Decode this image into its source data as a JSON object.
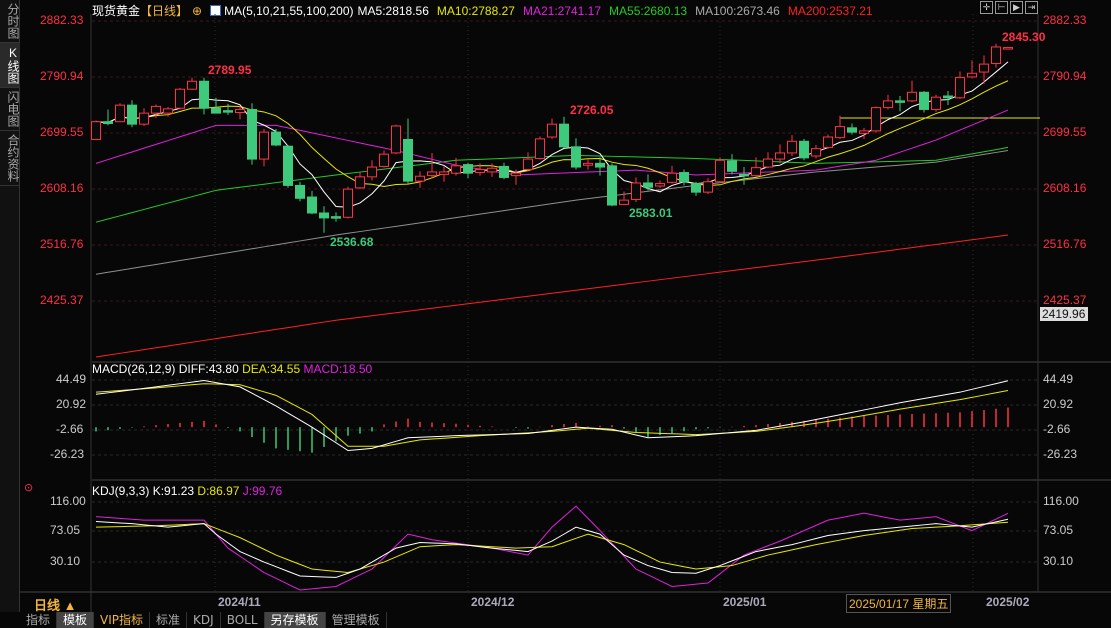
{
  "sidebar": {
    "tabs": [
      {
        "label": "分时图"
      },
      {
        "label": "K线图"
      },
      {
        "label": "闪电图"
      },
      {
        "label": "合约资料"
      }
    ]
  },
  "header": {
    "name": "现货黄金",
    "period": "【日线】",
    "ma_label": "MA(5,10,21,55,100,200)",
    "ma5": "MA5:2818.56",
    "ma10": "MA10:2788.27",
    "ma21": "MA21:2741.17",
    "ma55": "MA55:2680.13",
    "ma100": "MA100:2673.46",
    "ma200": "MA200:2537.21"
  },
  "colors": {
    "up": "#ff3046",
    "down": "#3ec97c",
    "ma5": "#ffffff",
    "ma10": "#e8e800",
    "ma21": "#e020e0",
    "ma55": "#22cc22",
    "ma100": "#909090",
    "ma200": "#ff2020"
  },
  "price_axis": [
    "2882.33",
    "2790.94",
    "2699.55",
    "2608.16",
    "2516.76",
    "2425.37"
  ],
  "price_box": "2419.96",
  "annotations": {
    "high1": "2789.95",
    "high2": "2726.05",
    "low1": "2536.68",
    "low2": "2583.01",
    "last_high": "2845.30"
  },
  "macd": {
    "title": "MACD(26,12,9)",
    "diff": "DIFF:43.80",
    "dea": "DEA:34.55",
    "macd": "MACD:18.50",
    "axis": [
      "44.49",
      "20.92",
      "-2.66",
      "-26.23"
    ]
  },
  "kdj": {
    "title": "KDJ(9,3,3)",
    "k": "K:91.23",
    "d": "D:86.97",
    "j": "J:99.76",
    "axis": [
      "116.00",
      "73.05",
      "30.10"
    ]
  },
  "dates": {
    "d1": "2024/11",
    "d2": "2024/12",
    "d3": "2025/01",
    "d4": "2025/02",
    "cursor": "2025/01/17 星期五"
  },
  "period_selector": "日线 ▲",
  "toolbar": [
    "指标",
    "模板",
    "VIP指标",
    "标准",
    "KDJ",
    "BOLL",
    "另存模板",
    "管理模板"
  ],
  "chart_data": {
    "type": "candlestick",
    "candles": [
      [
        2689,
        2720,
        2688,
        2718
      ],
      [
        2718,
        2738,
        2712,
        2715
      ],
      [
        2718,
        2748,
        2718,
        2745
      ],
      [
        2745,
        2753,
        2709,
        2714
      ],
      [
        2714,
        2740,
        2711,
        2732
      ],
      [
        2732,
        2746,
        2724,
        2743
      ],
      [
        2732,
        2742,
        2726,
        2739
      ],
      [
        2740,
        2773,
        2738,
        2771
      ],
      [
        2771,
        2790,
        2770,
        2784
      ],
      [
        2784,
        2789.95,
        2730,
        2740
      ],
      [
        2740,
        2757,
        2732,
        2732
      ],
      [
        2736,
        2747,
        2729,
        2734
      ],
      [
        2733,
        2744,
        2722,
        2738
      ],
      [
        2738,
        2748,
        2648,
        2657
      ],
      [
        2657,
        2706,
        2645,
        2701
      ],
      [
        2701,
        2706,
        2678,
        2680
      ],
      [
        2678,
        2680,
        2610,
        2614
      ],
      [
        2614,
        2620,
        2588,
        2593
      ],
      [
        2595,
        2605,
        2567,
        2569
      ],
      [
        2569,
        2580,
        2536.68,
        2561
      ],
      [
        2563,
        2570,
        2555,
        2561
      ],
      [
        2562,
        2612,
        2560,
        2608
      ],
      [
        2610,
        2636,
        2608,
        2628
      ],
      [
        2628,
        2655,
        2622,
        2644
      ],
      [
        2645,
        2671,
        2643,
        2665
      ],
      [
        2667,
        2713,
        2665,
        2711
      ],
      [
        2689,
        2723,
        2616,
        2621
      ],
      [
        2621,
        2637,
        2610,
        2629
      ],
      [
        2630,
        2667,
        2625,
        2636
      ],
      [
        2632,
        2645,
        2620,
        2636
      ],
      [
        2634,
        2659,
        2630,
        2646
      ],
      [
        2648,
        2651,
        2626,
        2634
      ],
      [
        2635,
        2650,
        2630,
        2640
      ],
      [
        2636,
        2650,
        2628,
        2642
      ],
      [
        2645,
        2651,
        2624,
        2627
      ],
      [
        2630,
        2640,
        2615,
        2634
      ],
      [
        2640,
        2668,
        2638,
        2657
      ],
      [
        2658,
        2694,
        2656,
        2690
      ],
      [
        2693,
        2723,
        2690,
        2714
      ],
      [
        2714,
        2726.05,
        2675,
        2677
      ],
      [
        2677,
        2691,
        2640,
        2644
      ],
      [
        2647,
        2657,
        2640,
        2650
      ],
      [
        2650,
        2660,
        2630,
        2644
      ],
      [
        2646,
        2650,
        2580,
        2582
      ],
      [
        2583,
        2604,
        2583.01,
        2590
      ],
      [
        2591,
        2627,
        2587,
        2618
      ],
      [
        2618,
        2632,
        2606,
        2611
      ],
      [
        2613,
        2622,
        2610,
        2617
      ],
      [
        2619,
        2646,
        2617,
        2634
      ],
      [
        2635,
        2640,
        2614,
        2620
      ],
      [
        2617,
        2620,
        2597,
        2603
      ],
      [
        2603,
        2626,
        2600,
        2620
      ],
      [
        2620,
        2660,
        2618,
        2655
      ],
      [
        2654,
        2665,
        2632,
        2637
      ],
      [
        2632,
        2644,
        2615,
        2631
      ],
      [
        2630,
        2660,
        2628,
        2643
      ],
      [
        2644,
        2668,
        2642,
        2657
      ],
      [
        2657,
        2681,
        2650,
        2667
      ],
      [
        2667,
        2696,
        2662,
        2686
      ],
      [
        2686,
        2690,
        2655,
        2659
      ],
      [
        2662,
        2680,
        2658,
        2674
      ],
      [
        2676,
        2697,
        2674,
        2693
      ],
      [
        2692,
        2728,
        2690,
        2710
      ],
      [
        2708,
        2715,
        2697,
        2701
      ],
      [
        2699,
        2708,
        2690,
        2703
      ],
      [
        2703,
        2743,
        2700,
        2741
      ],
      [
        2741,
        2762,
        2738,
        2752
      ],
      [
        2752,
        2760,
        2735,
        2751
      ],
      [
        2752,
        2785,
        2750,
        2766
      ],
      [
        2766,
        2768,
        2733,
        2738
      ],
      [
        2738,
        2762,
        2734,
        2758
      ],
      [
        2760,
        2768,
        2745,
        2757
      ],
      [
        2757,
        2800,
        2755,
        2790
      ],
      [
        2791,
        2818,
        2789,
        2797
      ],
      [
        2799,
        2826,
        2780,
        2812
      ],
      [
        2813,
        2845.3,
        2806,
        2840
      ],
      [
        2838,
        2840,
        2837,
        2839
      ]
    ],
    "ma21": [
      [
        0,
        2650
      ],
      [
        10,
        2712
      ],
      [
        15,
        2712
      ],
      [
        25,
        2671
      ],
      [
        30,
        2647
      ],
      [
        35,
        2631
      ],
      [
        45,
        2639
      ],
      [
        50,
        2631
      ],
      [
        60,
        2639
      ],
      [
        65,
        2655
      ],
      [
        70,
        2688
      ],
      [
        76,
        2737
      ]
    ],
    "ma55": [
      [
        0,
        2554
      ],
      [
        10,
        2606
      ],
      [
        20,
        2631
      ],
      [
        30,
        2655
      ],
      [
        40,
        2663
      ],
      [
        50,
        2658
      ],
      [
        60,
        2650
      ],
      [
        70,
        2655
      ],
      [
        76,
        2676
      ]
    ],
    "ma100": [
      [
        0,
        2469
      ],
      [
        20,
        2533
      ],
      [
        40,
        2590
      ],
      [
        50,
        2614
      ],
      [
        60,
        2636
      ],
      [
        70,
        2652
      ],
      [
        76,
        2671
      ]
    ],
    "ma200": [
      [
        0,
        2334
      ],
      [
        20,
        2394
      ],
      [
        40,
        2443
      ],
      [
        60,
        2492
      ],
      [
        76,
        2533
      ]
    ],
    "resistance_line": 2724,
    "macd_diff": [
      [
        0,
        31
      ],
      [
        5,
        38
      ],
      [
        9,
        44
      ],
      [
        12,
        38
      ],
      [
        15,
        20
      ],
      [
        18,
        0
      ],
      [
        21,
        -22
      ],
      [
        23,
        -20
      ],
      [
        26,
        -10
      ],
      [
        30,
        -8
      ],
      [
        36,
        -6
      ],
      [
        40,
        0
      ],
      [
        43,
        -2
      ],
      [
        46,
        -10
      ],
      [
        50,
        -8
      ],
      [
        55,
        -3
      ],
      [
        59,
        5
      ],
      [
        63,
        14
      ],
      [
        67,
        23
      ],
      [
        72,
        33
      ],
      [
        76,
        43.8
      ]
    ],
    "macd_dea": [
      [
        0,
        33
      ],
      [
        5,
        37
      ],
      [
        9,
        41
      ],
      [
        12,
        40
      ],
      [
        15,
        30
      ],
      [
        18,
        12
      ],
      [
        21,
        -18
      ],
      [
        24,
        -18
      ],
      [
        27,
        -12
      ],
      [
        32,
        -8
      ],
      [
        38,
        -4
      ],
      [
        41,
        -1
      ],
      [
        45,
        -5
      ],
      [
        50,
        -7
      ],
      [
        55,
        -4
      ],
      [
        59,
        2
      ],
      [
        63,
        9
      ],
      [
        67,
        17
      ],
      [
        72,
        26
      ],
      [
        76,
        34.55
      ]
    ],
    "kdj_k": [
      [
        0,
        88
      ],
      [
        3,
        85
      ],
      [
        6,
        80
      ],
      [
        9,
        85
      ],
      [
        10,
        70
      ],
      [
        12,
        45
      ],
      [
        14,
        30
      ],
      [
        17,
        10
      ],
      [
        20,
        8
      ],
      [
        22,
        20
      ],
      [
        25,
        50
      ],
      [
        27,
        58
      ],
      [
        30,
        56
      ],
      [
        33,
        50
      ],
      [
        36,
        45
      ],
      [
        38,
        60
      ],
      [
        40,
        80
      ],
      [
        42,
        70
      ],
      [
        44,
        40
      ],
      [
        46,
        25
      ],
      [
        48,
        15
      ],
      [
        50,
        14
      ],
      [
        52,
        25
      ],
      [
        55,
        45
      ],
      [
        58,
        55
      ],
      [
        61,
        68
      ],
      [
        64,
        75
      ],
      [
        67,
        80
      ],
      [
        70,
        85
      ],
      [
        73,
        80
      ],
      [
        76,
        91.23
      ]
    ],
    "kdj_d": [
      [
        0,
        80
      ],
      [
        5,
        82
      ],
      [
        9,
        85
      ],
      [
        12,
        65
      ],
      [
        15,
        40
      ],
      [
        18,
        20
      ],
      [
        21,
        15
      ],
      [
        24,
        30
      ],
      [
        27,
        52
      ],
      [
        30,
        55
      ],
      [
        35,
        50
      ],
      [
        38,
        52
      ],
      [
        41,
        70
      ],
      [
        44,
        55
      ],
      [
        47,
        30
      ],
      [
        50,
        20
      ],
      [
        53,
        25
      ],
      [
        56,
        40
      ],
      [
        60,
        55
      ],
      [
        64,
        68
      ],
      [
        68,
        78
      ],
      [
        72,
        82
      ],
      [
        76,
        86.97
      ]
    ],
    "kdj_j": [
      [
        0,
        95
      ],
      [
        4,
        90
      ],
      [
        9,
        90
      ],
      [
        11,
        50
      ],
      [
        14,
        15
      ],
      [
        17,
        -10
      ],
      [
        20,
        -5
      ],
      [
        23,
        20
      ],
      [
        26,
        70
      ],
      [
        28,
        62
      ],
      [
        33,
        50
      ],
      [
        36,
        40
      ],
      [
        38,
        80
      ],
      [
        40,
        110
      ],
      [
        42,
        75
      ],
      [
        45,
        20
      ],
      [
        48,
        -5
      ],
      [
        51,
        0
      ],
      [
        54,
        40
      ],
      [
        57,
        60
      ],
      [
        61,
        90
      ],
      [
        64,
        100
      ],
      [
        67,
        90
      ],
      [
        70,
        95
      ],
      [
        73,
        75
      ],
      [
        76,
        99.76
      ]
    ]
  }
}
